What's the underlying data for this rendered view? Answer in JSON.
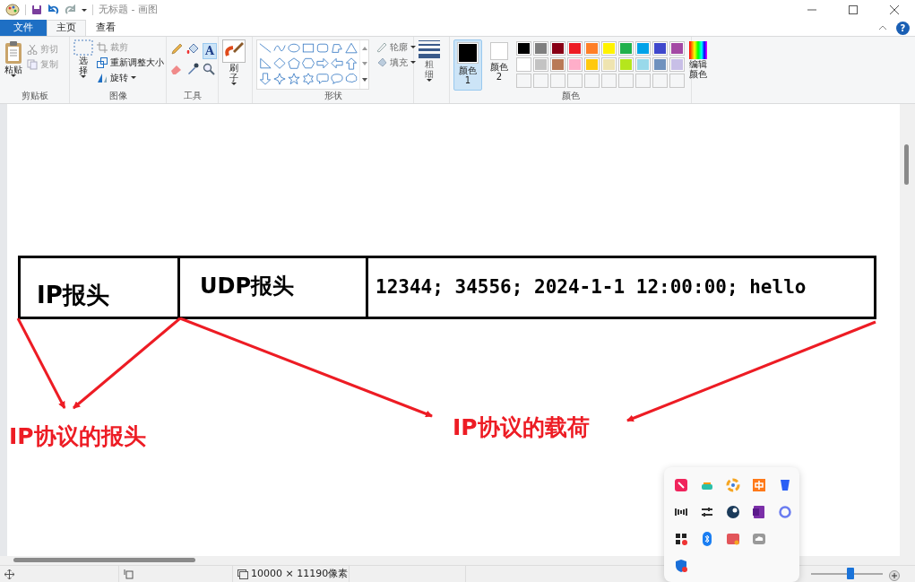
{
  "window": {
    "title": "无标题 - 画图",
    "help": "?"
  },
  "tabs": [
    {
      "label": "文件",
      "kind": "file",
      "selected": false
    },
    {
      "label": "主页",
      "kind": "tab",
      "selected": true
    },
    {
      "label": "查看",
      "kind": "tab",
      "selected": false
    }
  ],
  "ribbon": {
    "clipboard": {
      "label": "剪贴板",
      "paste": "粘贴",
      "items": [
        {
          "label": "剪切",
          "disabled": true
        },
        {
          "label": "复制",
          "disabled": true
        }
      ]
    },
    "image": {
      "label": "图像",
      "select": "选择",
      "items": [
        {
          "label": "裁剪",
          "disabled": true,
          "dropdown": false
        },
        {
          "label": "重新调整大小",
          "disabled": false,
          "dropdown": false
        },
        {
          "label": "旋转",
          "disabled": false,
          "dropdown": true
        }
      ]
    },
    "tools": {
      "label": "工具",
      "text_tool": "A"
    },
    "brushes": {
      "label": "刷子"
    },
    "shapes": {
      "label": "形状",
      "options": [
        {
          "label": "轮廓"
        },
        {
          "label": "填充"
        }
      ]
    },
    "size": {
      "label": "粗细"
    },
    "colors": {
      "label": "颜色",
      "current": [
        {
          "label": "颜色 1",
          "selected": true,
          "color": "#000000"
        },
        {
          "label": "颜色 2",
          "selected": false,
          "color": "#ffffff"
        }
      ],
      "palette": [
        {
          "color": "#000000"
        },
        {
          "color": "#7f7f7f"
        },
        {
          "color": "#880015"
        },
        {
          "color": "#ed1c24"
        },
        {
          "color": "#ff7f27"
        },
        {
          "color": "#fff200"
        },
        {
          "color": "#22b14c"
        },
        {
          "color": "#00a2e8"
        },
        {
          "color": "#3f48cc"
        },
        {
          "color": "#a349a4"
        },
        {
          "color": "#ffffff"
        },
        {
          "color": "#c3c3c3"
        },
        {
          "color": "#b97a57"
        },
        {
          "color": "#ffaec9"
        },
        {
          "color": "#ffc90e"
        },
        {
          "color": "#efe4b0"
        },
        {
          "color": "#b5e61d"
        },
        {
          "color": "#99d9ea"
        },
        {
          "color": "#7092be"
        },
        {
          "color": "#c8bfe7"
        }
      ],
      "edit": "编辑颜色"
    }
  },
  "canvas": {
    "cells": [
      "IP报头",
      "UDP报头",
      "12344; 34556; 2024-1-1 12:00:00; hello"
    ],
    "annotations": [
      "IP协议的报头",
      "IP协议的载荷"
    ]
  },
  "status_bar": {
    "canvas_size": "10000 × 11190像素",
    "zoom": {
      "level": 0.55
    }
  }
}
